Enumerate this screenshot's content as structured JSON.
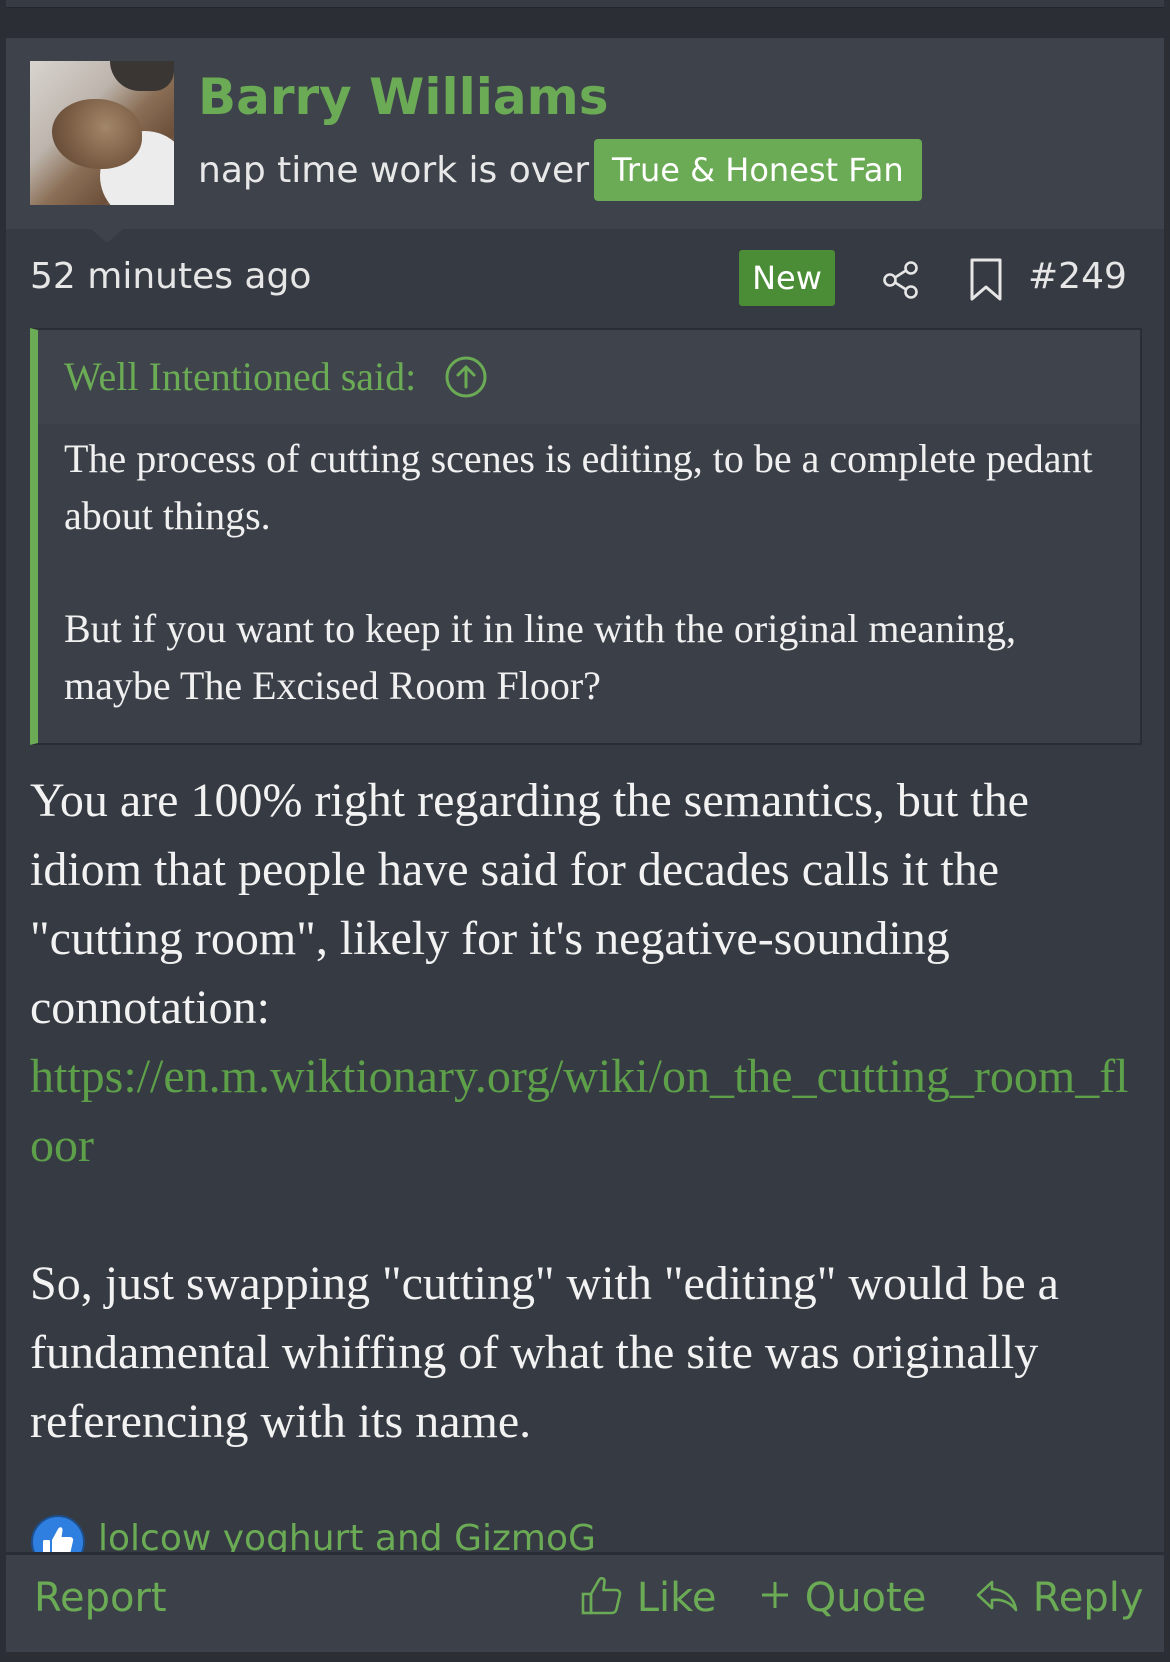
{
  "post": {
    "user": {
      "name": "Barry Williams",
      "title": "nap time work is over",
      "banner": "True & Honest Fan",
      "avatar_icon": "cat-avatar"
    },
    "meta": {
      "timestamp": "52 minutes ago",
      "new_badge": "New",
      "share_icon": "share-icon",
      "bookmark_icon": "bookmark-icon",
      "post_number": "#249"
    },
    "quote": {
      "attribution": "Well Intentioned said:",
      "jump_icon": "arrow-up-circle-icon",
      "paragraphs": [
        "The process of cutting scenes is editing, to be a complete pedant about things.",
        "But if you want to keep it in line with the original meaning, maybe The Excised Room Floor?"
      ]
    },
    "message": {
      "paragraph1": "You are 100% right regarding the semantics, but the idiom that people have said for decades calls it the \"cutting room\", likely for it's negative-sounding connotation:",
      "link": "https://en.m.wiktionary.org/wiki/on_the_cutting_room_floor",
      "paragraph2": "So, just swapping \"cutting\" with \"editing\" would be a fundamental whiffing of what the site was originally referencing with its name."
    },
    "reactions": {
      "icon": "thumbs-up-reaction-icon",
      "users": "lolcow yoghurt and GizmoG"
    },
    "actions": {
      "report": "Report",
      "like": "Like",
      "quote": "Quote",
      "reply": "Reply"
    }
  },
  "colors": {
    "accent": "#6bab55",
    "link": "#5ea04a",
    "background": "#363a42",
    "header_background": "#3e434b",
    "new_badge": "#4b8c36",
    "reaction_blue": "#2f7fe0"
  }
}
